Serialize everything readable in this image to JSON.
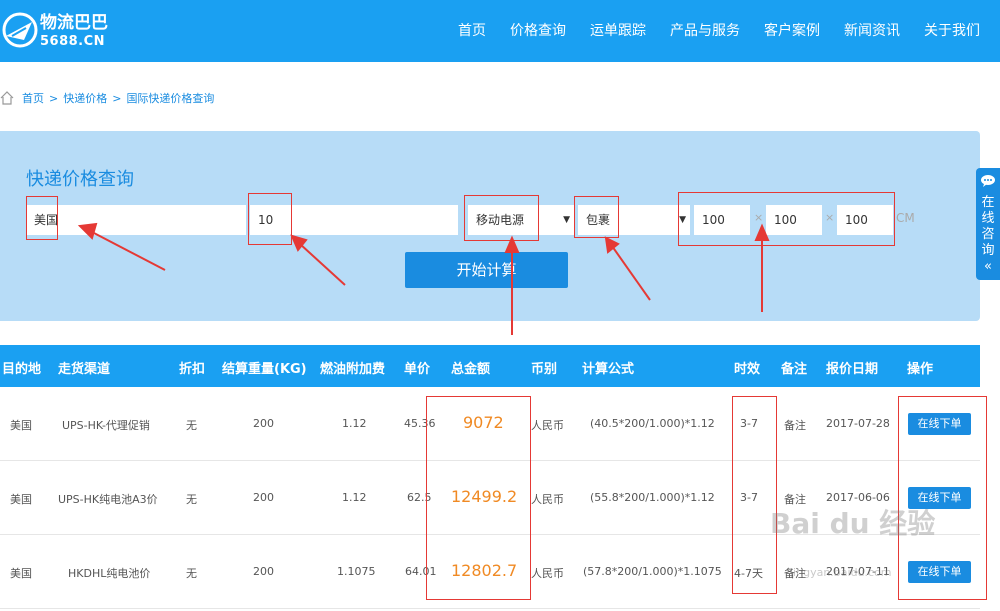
{
  "header": {
    "logo_name": "物流巴巴",
    "logo_domain": "5688.CN",
    "nav": [
      "首页",
      "价格查询",
      "运单跟踪",
      "产品与服务",
      "客户案例",
      "新闻资讯",
      "关于我们"
    ]
  },
  "breadcrumb": [
    "首页",
    "快递价格",
    "国际快递价格查询"
  ],
  "query": {
    "title": "快递价格查询",
    "destination": "美国",
    "weight": "10",
    "goods_type": "移动电源",
    "package_type": "包裹",
    "length": "100",
    "width": "100",
    "height": "100",
    "dim_sep": "×",
    "unit": "CM",
    "submit_label": "开始计算"
  },
  "side_tab": {
    "label": "在线咨询",
    "arrow": "«"
  },
  "table": {
    "headers": [
      "目的地",
      "走货渠道",
      "折扣",
      "结算重量(KG)",
      "燃油附加费",
      "单价",
      "总金额",
      "币别",
      "计算公式",
      "时效",
      "备注",
      "报价日期",
      "操作"
    ],
    "rows": [
      {
        "dest": "美国",
        "channel": "UPS-HK-代理促销",
        "discount": "无",
        "weight": "200",
        "fuel": "1.12",
        "unit_price": "45.36",
        "total": "9072",
        "currency": "人民币",
        "formula": "(40.5*200/1.000)*1.12",
        "time": "3-7",
        "remark": "备注",
        "date": "2017-07-28",
        "action": "在线下单"
      },
      {
        "dest": "美国",
        "channel": "UPS-HK纯电池A3价",
        "discount": "无",
        "weight": "200",
        "fuel": "1.12",
        "unit_price": "62.5",
        "total": "12499.2",
        "currency": "人民币",
        "formula": "(55.8*200/1.000)*1.12",
        "time": "3-7",
        "remark": "备注",
        "date": "2017-06-06",
        "action": "在线下单"
      },
      {
        "dest": "美国",
        "channel": "HKDHL纯电池价",
        "discount": "无",
        "weight": "200",
        "fuel": "1.1075",
        "unit_price": "64.01",
        "total": "12802.7",
        "currency": "人民币",
        "formula": "(57.8*200/1.000)*1.1075",
        "time": "4-7天",
        "remark": "备注",
        "date": "2017-07-11",
        "action": "在线下单"
      }
    ]
  },
  "colors": {
    "brand": "#1aa0f2",
    "panel": "#b7dcf7",
    "total": "#f08a24",
    "annotation": "#e53935"
  },
  "watermark": {
    "text": "Bai du 经验",
    "sub": "jingyan.baidu.com"
  }
}
